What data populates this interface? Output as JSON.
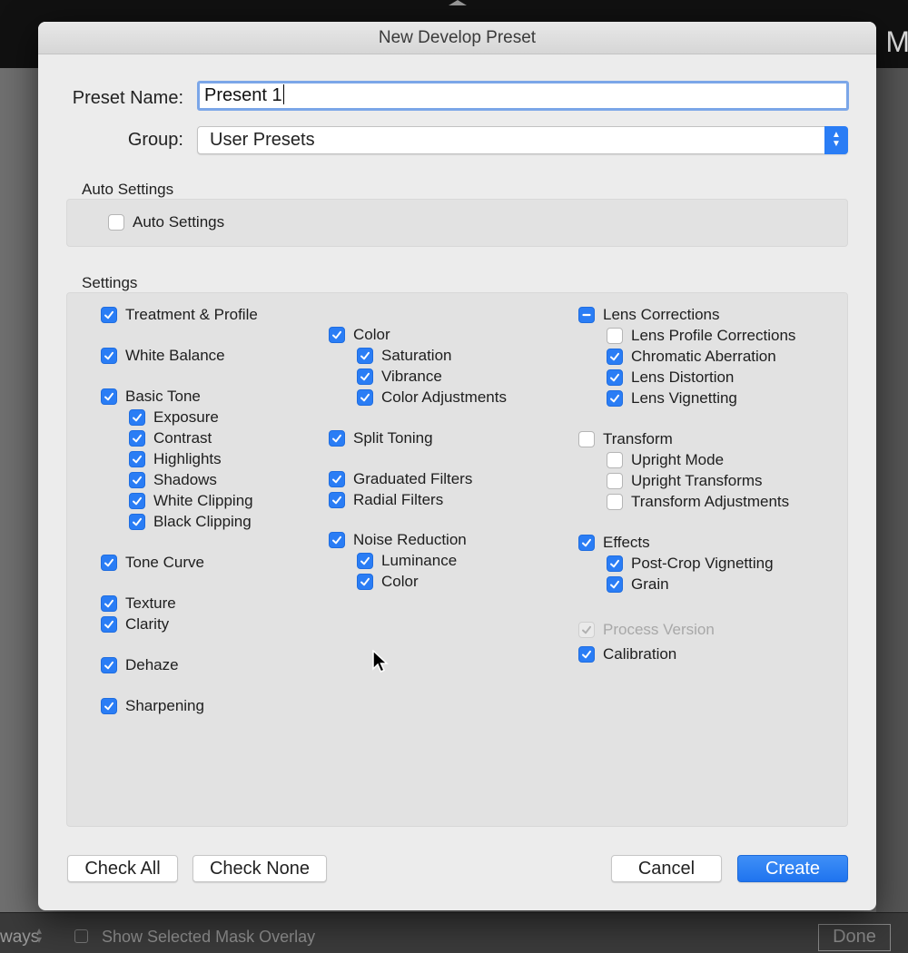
{
  "window": {
    "title": "New Develop Preset"
  },
  "background": {
    "top_glyph": "M",
    "bottom_left_text": "ways",
    "mask_overlay_label": "Show Selected Mask Overlay",
    "done_label": "Done"
  },
  "form": {
    "preset_name_label": "Preset Name:",
    "preset_name_value": "Present 1",
    "group_label": "Group:",
    "group_value": "User Presets"
  },
  "auto_settings": {
    "section_label": "Auto Settings",
    "checkbox_label": "Auto Settings",
    "checked": false
  },
  "settings": {
    "section_label": "Settings",
    "column1": [
      {
        "label": "Treatment & Profile",
        "state": "on"
      },
      {
        "label": "White Balance",
        "state": "on"
      },
      {
        "label": "Basic Tone",
        "state": "on"
      },
      {
        "label": "Exposure",
        "state": "on"
      },
      {
        "label": "Contrast",
        "state": "on"
      },
      {
        "label": "Highlights",
        "state": "on"
      },
      {
        "label": "Shadows",
        "state": "on"
      },
      {
        "label": "White Clipping",
        "state": "on"
      },
      {
        "label": "Black Clipping",
        "state": "on"
      },
      {
        "label": "Tone Curve",
        "state": "on"
      },
      {
        "label": "Texture",
        "state": "on"
      },
      {
        "label": "Clarity",
        "state": "on"
      },
      {
        "label": "Dehaze",
        "state": "on"
      },
      {
        "label": "Sharpening",
        "state": "on"
      }
    ],
    "column2": [
      {
        "label": "Color",
        "state": "on"
      },
      {
        "label": "Saturation",
        "state": "on"
      },
      {
        "label": "Vibrance",
        "state": "on"
      },
      {
        "label": "Color Adjustments",
        "state": "on"
      },
      {
        "label": "Split Toning",
        "state": "on"
      },
      {
        "label": "Graduated Filters",
        "state": "on"
      },
      {
        "label": "Radial Filters",
        "state": "on"
      },
      {
        "label": "Noise Reduction",
        "state": "on"
      },
      {
        "label": "Luminance",
        "state": "on"
      },
      {
        "label": "Color",
        "state": "on"
      }
    ],
    "column3": [
      {
        "label": "Lens Corrections",
        "state": "mixed"
      },
      {
        "label": "Lens Profile Corrections",
        "state": "off"
      },
      {
        "label": "Chromatic Aberration",
        "state": "on"
      },
      {
        "label": "Lens Distortion",
        "state": "on"
      },
      {
        "label": "Lens Vignetting",
        "state": "on"
      },
      {
        "label": "Transform",
        "state": "off"
      },
      {
        "label": "Upright Mode",
        "state": "off"
      },
      {
        "label": "Upright Transforms",
        "state": "off"
      },
      {
        "label": "Transform Adjustments",
        "state": "off"
      },
      {
        "label": "Effects",
        "state": "on"
      },
      {
        "label": "Post-Crop Vignetting",
        "state": "on"
      },
      {
        "label": "Grain",
        "state": "on"
      },
      {
        "label": "Process Version",
        "state": "disabled"
      },
      {
        "label": "Calibration",
        "state": "on"
      }
    ]
  },
  "buttons": {
    "check_all": "Check All",
    "check_none": "Check None",
    "cancel": "Cancel",
    "create": "Create"
  },
  "colors": {
    "accent": "#2a7df5",
    "dialog_bg": "#ececec",
    "panel_bg": "#e2e2e2"
  }
}
